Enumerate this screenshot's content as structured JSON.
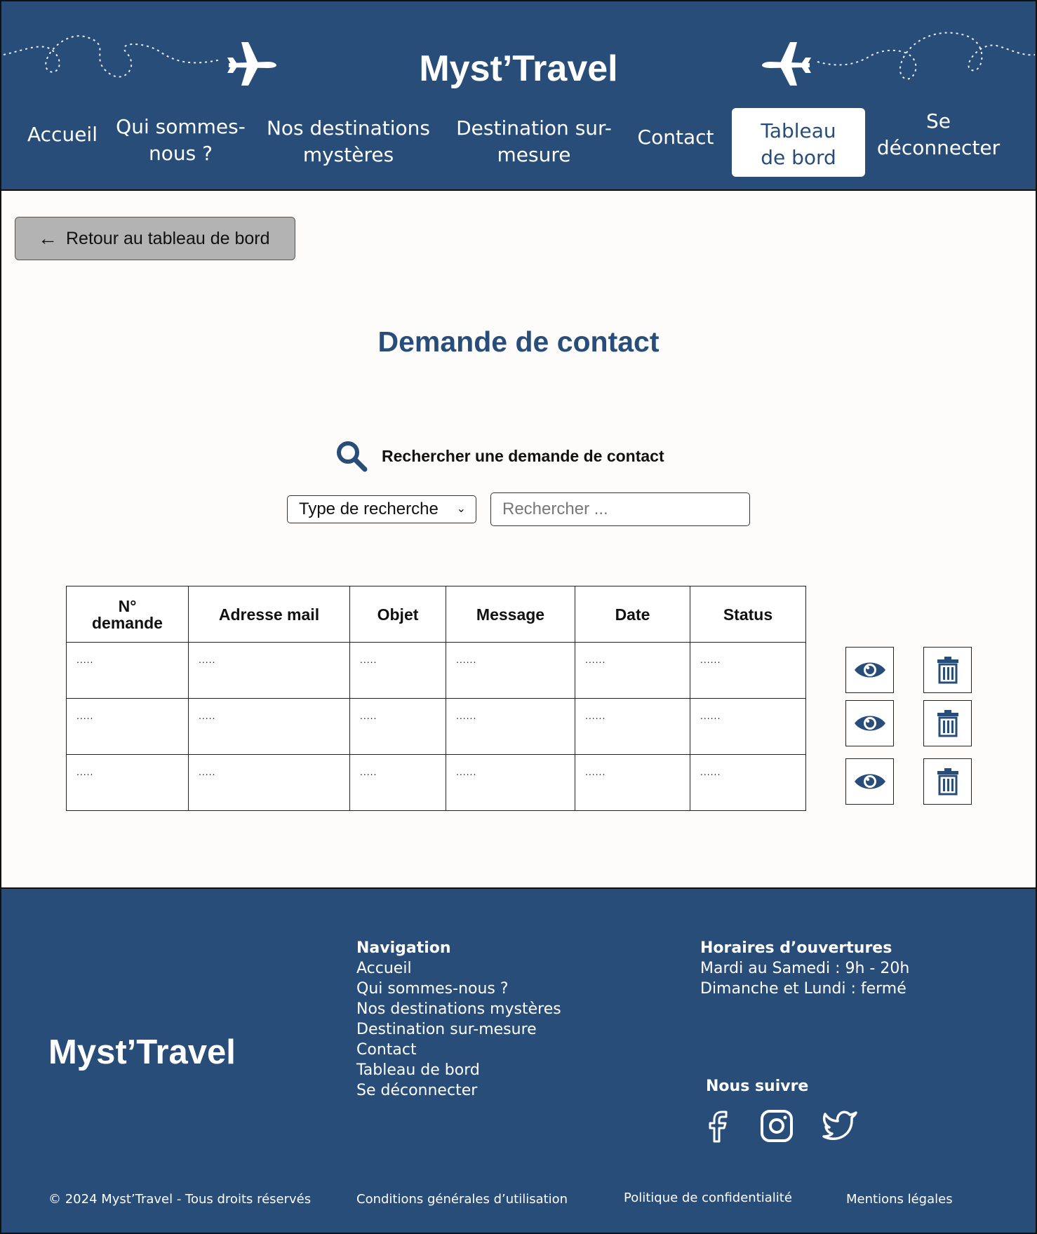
{
  "header": {
    "title": "Myst’Travel",
    "nav": [
      {
        "id": "accueil",
        "label": "Accueil"
      },
      {
        "id": "qui",
        "label": "Qui sommes-nous ?"
      },
      {
        "id": "destinations",
        "label": "Nos destinations mystères"
      },
      {
        "id": "surmesure",
        "label": "Destination sur-mesure"
      },
      {
        "id": "contact",
        "label": "Contact"
      },
      {
        "id": "tableau",
        "label": "Tableau de bord",
        "active": true
      },
      {
        "id": "deconnecter",
        "label": "Se déconnecter"
      }
    ]
  },
  "main": {
    "back_button": "Retour au tableau de bord",
    "title": "Demande de contact",
    "search_label": "Rechercher une demande de contact",
    "select_value": "Type de recherche",
    "search_placeholder": "Rechercher ...",
    "table": {
      "headers": [
        "N° demande",
        "Adresse mail",
        "Objet",
        "Message",
        "Date",
        "Status"
      ],
      "rows": [
        [
          ".....",
          ".....",
          ".....",
          "......",
          "......",
          "......"
        ],
        [
          ".....",
          ".....",
          ".....",
          "......",
          "......",
          "......"
        ],
        [
          ".....",
          ".....",
          ".....",
          "......",
          "......",
          "......"
        ]
      ]
    },
    "row_actions": [
      "eye-icon",
      "trash-icon"
    ]
  },
  "footer": {
    "logo": "Myst’Travel",
    "navigation": {
      "heading": "Navigation",
      "links": [
        "Accueil",
        "Qui sommes-nous ?",
        "Nos destinations mystères",
        "Destination sur-mesure",
        "Contact",
        "Tableau de bord",
        "Se déconnecter"
      ]
    },
    "hours": {
      "heading": "Horaires d’ouvertures",
      "lines": [
        "Mardi au Samedi : 9h - 20h",
        "Dimanche et Lundi : fermé"
      ]
    },
    "follow": {
      "heading": "Nous suivre",
      "icons": [
        "facebook-icon",
        "instagram-icon",
        "twitter-icon"
      ]
    },
    "copyright": "© 2024 Myst’Travel - Tous droits réservés",
    "cgu": "Conditions générales d’utilisation",
    "privacy": "Politique de confidentialité",
    "legal": "Mentions légales"
  },
  "colors": {
    "primary": "#284d79",
    "background": "#fdfcfa",
    "button_gray": "#b3b3b3"
  }
}
